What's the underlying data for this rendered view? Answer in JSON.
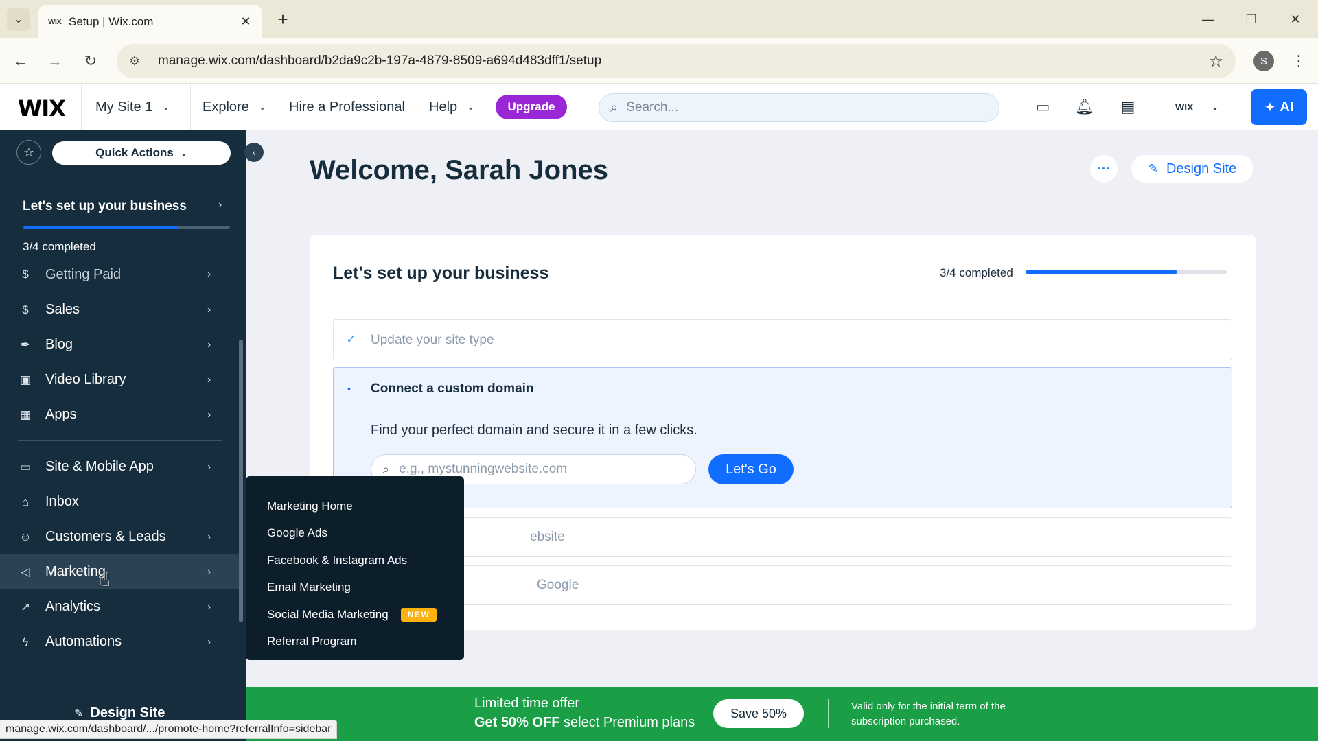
{
  "browser": {
    "tab_title": "Setup | Wix.com",
    "tab_favicon": "WIX",
    "url": "manage.wix.com/dashboard/b2da9c2b-197a-4879-8509-a694d483dff1/setup",
    "profile_initial": "S",
    "icons": {
      "tab_search": "chevron-down-icon",
      "new_tab": "plus-icon",
      "back": "arrow-left-icon",
      "forward": "arrow-right-icon",
      "reload": "reload-icon",
      "site_info": "tune-icon",
      "bookmark": "star-icon",
      "menu": "kebab-icon"
    }
  },
  "wix_header": {
    "logo": "WIX",
    "site_name": "My Site 1",
    "nav": [
      "Explore",
      "Hire a Professional",
      "Help"
    ],
    "upgrade_label": "Upgrade",
    "search_placeholder": "Search...",
    "account_logo": "WIX",
    "ai_label": "AI",
    "accent_color": "#116dff",
    "upgrade_color": "#9a27d5"
  },
  "sidebar": {
    "quick_actions_label": "Quick Actions",
    "setup_title": "Let's set up your business",
    "setup_progress": 0.75,
    "setup_completed": "3/4 completed",
    "items_top": [
      {
        "label": "Getting Paid",
        "icon": "dollar-doc-icon"
      },
      {
        "label": "Sales",
        "icon": "dollar-circle-icon"
      },
      {
        "label": "Blog",
        "icon": "pen-nib-icon"
      },
      {
        "label": "Video Library",
        "icon": "video-icon"
      },
      {
        "label": "Apps",
        "icon": "apps-icon"
      }
    ],
    "items_bottom": [
      {
        "label": "Site & Mobile App",
        "icon": "devices-icon"
      },
      {
        "label": "Inbox",
        "icon": "inbox-icon"
      },
      {
        "label": "Customers & Leads",
        "icon": "people-icon"
      },
      {
        "label": "Marketing",
        "icon": "megaphone-icon"
      },
      {
        "label": "Analytics",
        "icon": "chart-icon"
      },
      {
        "label": "Automations",
        "icon": "bolt-icon"
      }
    ],
    "design_site_label": "Design Site",
    "background_color": "#162d3d"
  },
  "marketing_flyout": {
    "items": [
      {
        "label": "Marketing Home"
      },
      {
        "label": "Google Ads"
      },
      {
        "label": "Facebook & Instagram Ads"
      },
      {
        "label": "Email Marketing"
      },
      {
        "label": "Social Media Marketing",
        "badge": "NEW"
      },
      {
        "label": "Referral Program"
      }
    ]
  },
  "main": {
    "welcome": "Welcome, Sarah Jones",
    "more_label": "···",
    "design_site_label": "Design Site",
    "setup_card": {
      "title": "Let's set up your business",
      "completed": "3/4 completed",
      "progress": 0.75,
      "steps": {
        "done": "Update your site type",
        "active_title": "Connect a custom domain",
        "active_desc": "Find your perfect domain and secure it in a few clicks.",
        "domain_placeholder": "e.g., mystunningwebsite.com",
        "lets_go": "Let's Go",
        "partial_3": "ebsite",
        "partial_4": "Google"
      }
    }
  },
  "promo": {
    "line1": "Limited time offer",
    "line2_bold": "Get 50% OFF",
    "line2_rest": "select Premium plans",
    "button": "Save 50%",
    "note": "Valid only for the initial term of the subscription purchased.",
    "color": "#1a9e46"
  },
  "status_url": "manage.wix.com/dashboard/.../promote-home?referralInfo=sidebar"
}
